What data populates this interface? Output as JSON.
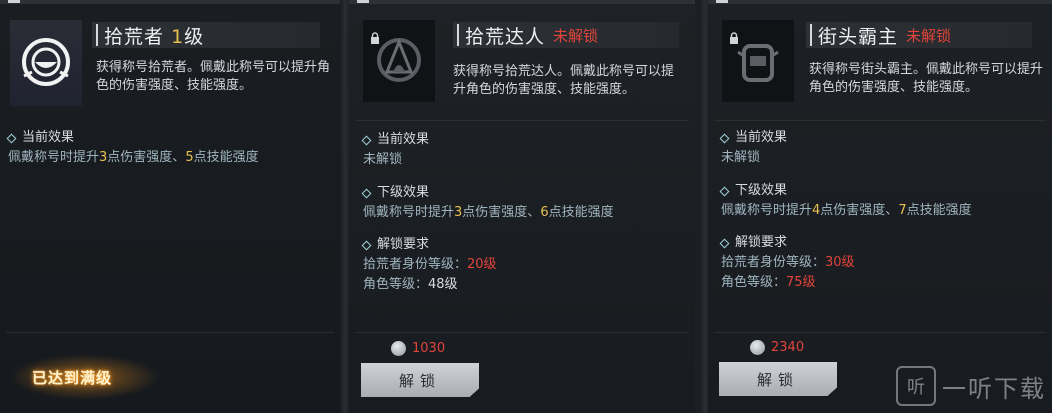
{
  "cards": [
    {
      "title": "拾荒者",
      "level": "1",
      "level_suffix": "级",
      "locked_tag": "",
      "description": "获得称号拾荒者。佩戴此称号可以提升角色的伤害强度、技能强度。",
      "current_effect": {
        "label": "当前效果",
        "prefix": "佩戴称号时提升",
        "dmg": "3",
        "dmg_text": "点伤害强度、",
        "skill": "5",
        "skill_text": "点技能强度"
      },
      "maxed_label": "已达到满级"
    },
    {
      "title": "拾荒达人",
      "locked_tag": "未解锁",
      "description": "获得称号拾荒达人。佩戴此称号可以提升角色的伤害强度、技能强度。",
      "current_effect": {
        "label": "当前效果",
        "value": "未解锁"
      },
      "next_effect": {
        "label": "下级效果",
        "prefix": "佩戴称号时提升",
        "dmg": "3",
        "dmg_text": "点伤害强度、",
        "skill": "6",
        "skill_text": "点技能强度"
      },
      "requirements": {
        "label": "解锁要求",
        "identity_label": "拾荒者身份等级：",
        "identity_value": "20级",
        "role_label": "角色等级：",
        "role_value": "48级"
      },
      "cost": "1030",
      "unlock_label": "解锁"
    },
    {
      "title": "街头霸主",
      "locked_tag": "未解锁",
      "description": "获得称号街头霸主。佩戴此称号可以提升角色的伤害强度、技能强度。",
      "current_effect": {
        "label": "当前效果",
        "value": "未解锁"
      },
      "next_effect": {
        "label": "下级效果",
        "prefix": "佩戴称号时提升",
        "dmg": "4",
        "dmg_text": "点伤害强度、",
        "skill": "7",
        "skill_text": "点技能强度"
      },
      "requirements": {
        "label": "解锁要求",
        "identity_label": "拾荒者身份等级：",
        "identity_value": "30级",
        "role_label": "角色等级：",
        "role_value": "75级"
      },
      "cost": "2340",
      "unlock_label": "解锁"
    }
  ],
  "watermark": {
    "icon_text": "听",
    "text": "一听下载"
  }
}
